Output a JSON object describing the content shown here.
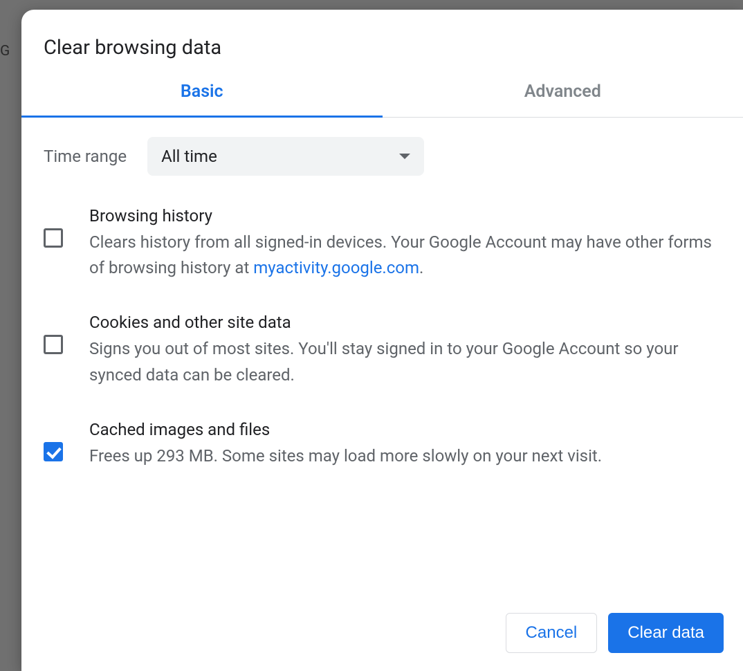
{
  "dialog": {
    "title": "Clear browsing data",
    "tabs": {
      "basic": "Basic",
      "advanced": "Advanced"
    },
    "time_range": {
      "label": "Time range",
      "value": "All time"
    },
    "options": {
      "browsing_history": {
        "title": "Browsing history",
        "desc_prefix": "Clears history from all signed-in devices. Your Google Account may have other forms of browsing history at ",
        "link_text": "myactivity.google.com",
        "desc_suffix": ".",
        "checked": false
      },
      "cookies": {
        "title": "Cookies and other site data",
        "desc": "Signs you out of most sites. You'll stay signed in to your Google Account so your synced data can be cleared.",
        "checked": false
      },
      "cache": {
        "title": "Cached images and files",
        "desc": "Frees up 293 MB. Some sites may load more slowly on your next visit.",
        "checked": true
      }
    },
    "buttons": {
      "cancel": "Cancel",
      "clear": "Clear data"
    }
  }
}
